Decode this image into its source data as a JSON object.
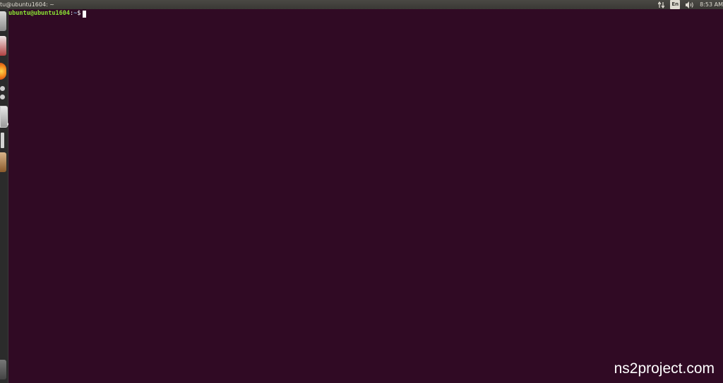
{
  "panel": {
    "window_title": "tu@ubuntu1604: ~",
    "keyboard_layout": "En",
    "clock": "8:53 AM"
  },
  "launcher": {
    "items": [
      {
        "name": "files",
        "icon": "files-icon"
      },
      {
        "name": "office",
        "icon": "libreoffice-icon"
      },
      {
        "name": "firefox",
        "icon": "firefox-icon"
      },
      {
        "name": "system-settings",
        "icon": "settings-icon"
      },
      {
        "name": "terminal",
        "icon": "terminal-icon",
        "active": true
      },
      {
        "name": "tools",
        "icon": "tools-icon"
      },
      {
        "name": "software",
        "icon": "package-icon"
      },
      {
        "name": "trash",
        "icon": "trash-icon"
      }
    ]
  },
  "terminal": {
    "user_host": "ubuntu@ubuntu1604",
    "separator": ":",
    "path": "~",
    "symbol": "$",
    "background": "#300a24",
    "user_color": "#8ae234",
    "path_color": "#729fcf"
  },
  "watermark": "ns2project.com"
}
